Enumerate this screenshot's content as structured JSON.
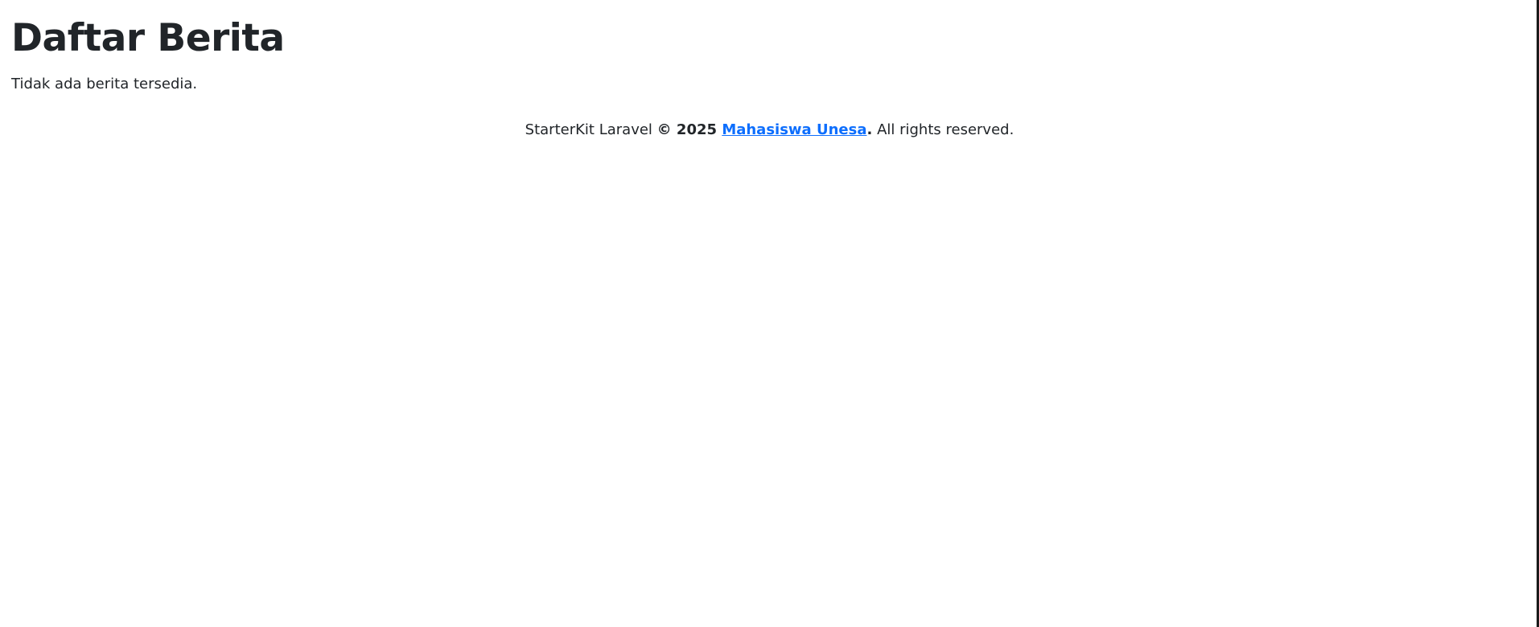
{
  "page": {
    "title": "Daftar Berita",
    "empty_message": "Tidak ada berita tersedia."
  },
  "footer": {
    "app_name": "StarterKit Laravel",
    "copyright": "© 2025",
    "author_link": "Mahasiswa Unesa",
    "period": ".",
    "rights": "All rights reserved."
  },
  "colors": {
    "text": "#212529",
    "link": "#0d6efd",
    "background": "#ffffff"
  }
}
